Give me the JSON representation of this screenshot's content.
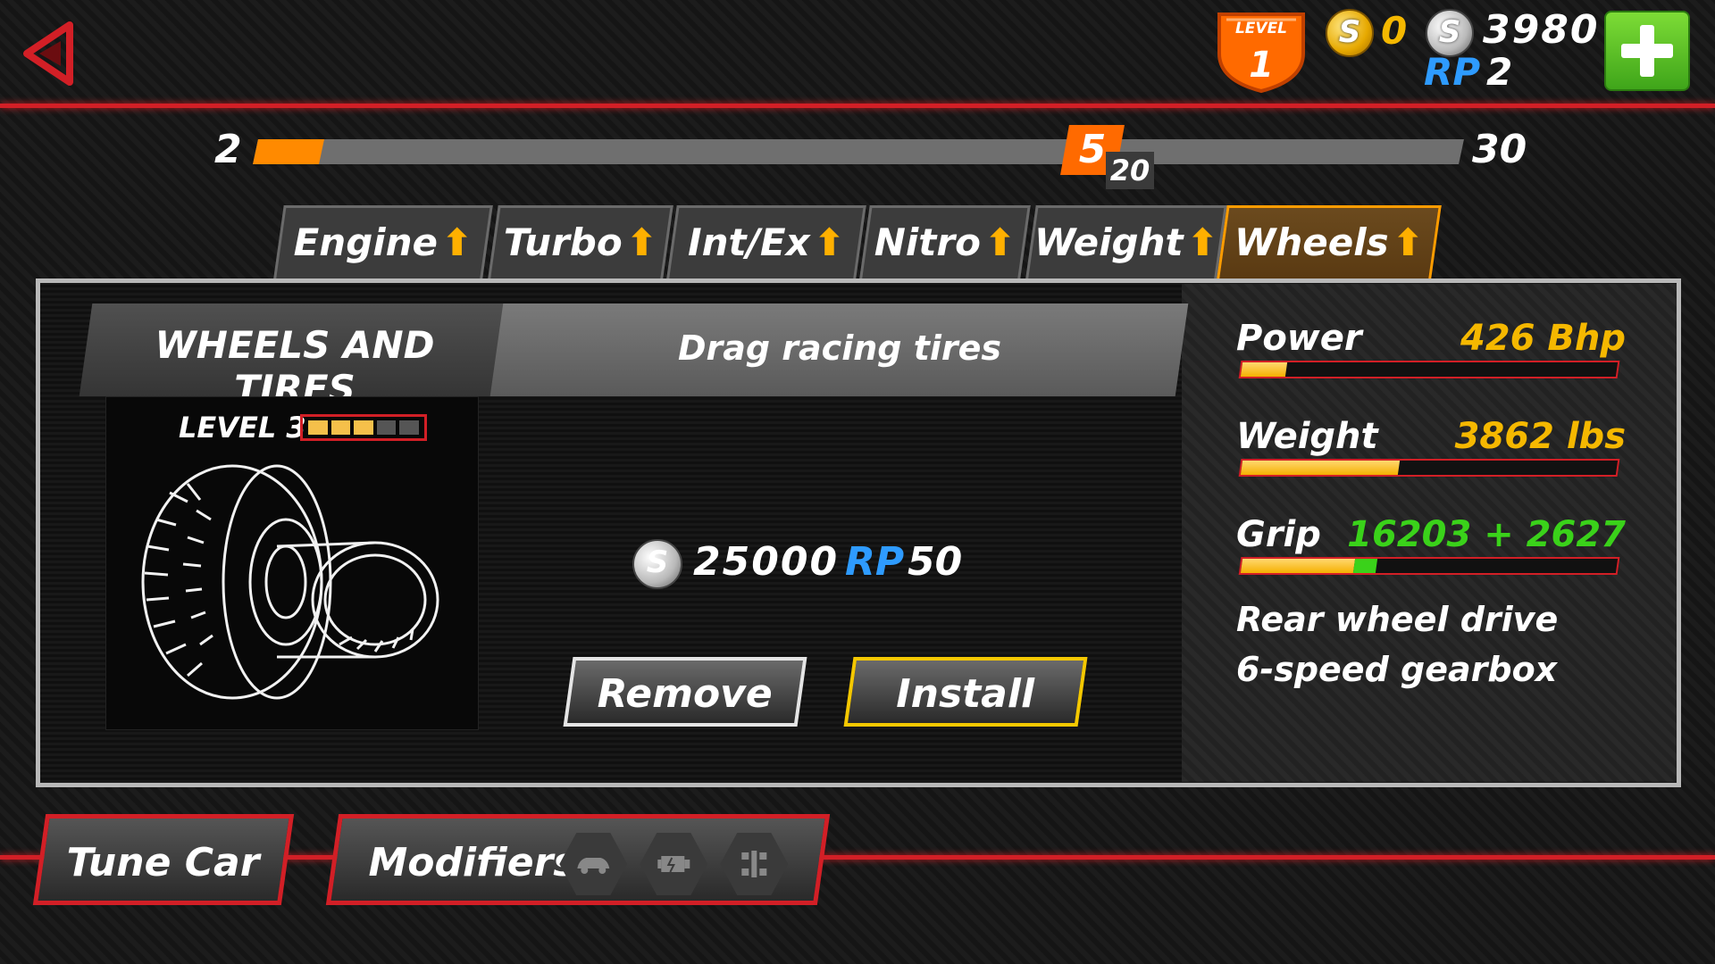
{
  "header": {
    "level_word": "LEVEL",
    "level_num": "1",
    "gold_value": "0",
    "silver_value": "3980",
    "rp_label": "RP",
    "rp_value": "2",
    "coin_symbol": "S"
  },
  "progress": {
    "min": "2",
    "max": "30",
    "marker": "5",
    "marker_sub": "20",
    "fill_fraction": 0.055
  },
  "tabs": [
    {
      "label": "Engine"
    },
    {
      "label": "Turbo"
    },
    {
      "label": "Int/Ex"
    },
    {
      "label": "Nitro"
    },
    {
      "label": "Weight"
    },
    {
      "label": "Wheels"
    }
  ],
  "active_tab": "Wheels",
  "part": {
    "category": "WHEELS AND TIRES",
    "name": "Drag racing tires",
    "level_text": "LEVEL 3",
    "level_filled": 3,
    "level_total": 5,
    "cost_symbol": "S",
    "cost_value": "25000",
    "cost_rp_label": "RP",
    "cost_rp_value": "50"
  },
  "buttons": {
    "remove": "Remove",
    "install": "Install"
  },
  "stats": {
    "power": {
      "label": "Power",
      "value": "426 Bhp",
      "fill": 0.12
    },
    "weight": {
      "label": "Weight",
      "value": "3862 lbs",
      "fill": 0.42
    },
    "grip": {
      "label": "Grip",
      "value": "16203 + 2627",
      "fill": 0.3,
      "bonus": 0.06
    },
    "drive": "Rear wheel drive",
    "gearbox": "6-speed gearbox"
  },
  "bottom": {
    "tune": "Tune Car",
    "modifiers": "Modifiers",
    "modifier_icons": [
      "car-icon",
      "engine-icon",
      "chassis-icon"
    ]
  },
  "colors": {
    "accent_red": "#d21f26",
    "orange": "#ff8a00",
    "gold": "#f5b800",
    "rp_blue": "#2e9bff",
    "grip_green": "#3ad21a"
  }
}
